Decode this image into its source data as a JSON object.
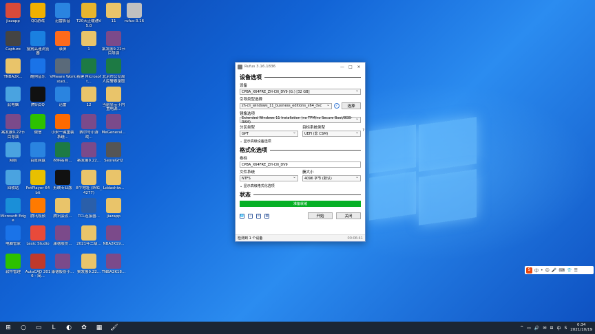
{
  "desktop_icons": [
    {
      "label": "jiazapp",
      "color": "#d84a3a"
    },
    {
      "label": "QQ游戏",
      "color": "#f0b000"
    },
    {
      "label": "迅雷影音",
      "color": "#2a84e0"
    },
    {
      "label": "T20天正暖通V5.0",
      "color": "#e7b52e"
    },
    {
      "label": "11",
      "color": "#e9c46a"
    },
    {
      "label": "rufus-3.16",
      "color": "#c0c0c0"
    },
    {
      "label": "Capture",
      "color": "#444444"
    },
    {
      "label": "搜狗高速浏览器",
      "color": "#1a80e0"
    },
    {
      "label": "录屏",
      "color": "#ff6a1a"
    },
    {
      "label": "1",
      "color": "#e9c46a"
    },
    {
      "label": "案发展9.22节目导演",
      "color": "#7b4a8a"
    },
    {
      "label": "TNBA2K...",
      "color": "#e9c46a"
    },
    {
      "label": "酷狗音乐",
      "color": "#1a73e8"
    },
    {
      "label": "VMware Workstati...",
      "color": "#5a6a7a"
    },
    {
      "label": "新建 Microsoft...",
      "color": "#1d7a44"
    },
    {
      "label": "北京市公安局人民警察录取",
      "color": "#1d7a44"
    },
    {
      "label": "此电脑",
      "color": "#4aa3e0"
    },
    {
      "label": "腾讯QQ",
      "color": "#111111"
    },
    {
      "label": "迅雷",
      "color": "#2a84e0"
    },
    {
      "label": "12",
      "color": "#e9c46a"
    },
    {
      "label": "当前显示于内置电源...",
      "color": "#e9c46a"
    },
    {
      "label": "案发展9.22节目导演",
      "color": "#7b4a8a"
    },
    {
      "label": "微信",
      "color": "#2dc100"
    },
    {
      "label": "小米一键重装系统...",
      "color": "#ff6a00"
    },
    {
      "label": "赛尔号小游戏...",
      "color": "#7b4a8a"
    },
    {
      "label": "MeGeneral...",
      "color": "#7b4a8a"
    },
    {
      "label": "网络",
      "color": "#4aa3e0"
    },
    {
      "label": "百度网盘",
      "color": "#2a84e0"
    },
    {
      "label": "材料名称...",
      "color": "#1d7a44"
    },
    {
      "label": "案发展9.22...",
      "color": "#7b4a8a"
    },
    {
      "label": "SeoreGH2",
      "color": "#555555"
    },
    {
      "label": "回收站",
      "color": "#4aa3e0"
    },
    {
      "label": "PotPlayer 64 bit",
      "color": "#e8c000"
    },
    {
      "label": "剪映专业版",
      "color": "#111111"
    },
    {
      "label": "8个地址 (IMG_4277)",
      "color": "#e9c46a"
    },
    {
      "label": "Lddashiw...",
      "color": "#e9c46a"
    },
    {
      "label": "Microsoft Edge",
      "color": "#1a8fd8"
    },
    {
      "label": "腾讯视频",
      "color": "#ff7a00"
    },
    {
      "label": "腾讯会议...",
      "color": "#e9c46a"
    },
    {
      "label": "TCL连接器...",
      "color": "#2a5faa"
    },
    {
      "label": "jiazapp",
      "color": "#e9c46a"
    },
    {
      "label": "电脑管家",
      "color": "#1a73e8"
    },
    {
      "label": "Lexic Studio",
      "color": "#e84a3a"
    },
    {
      "label": "康德股份...",
      "color": "#7b4a8a"
    },
    {
      "label": "2021年二级...",
      "color": "#e9c46a"
    },
    {
      "label": "NBA2K19...",
      "color": "#7b4a8a"
    },
    {
      "label": "软件管理",
      "color": "#2dc100"
    },
    {
      "label": "AutoCAD 2016 - 简...",
      "color": "#c0392b"
    },
    {
      "label": "康德股份小...",
      "color": "#7b4a8a"
    },
    {
      "label": "案发展9.22...",
      "color": "#e9c46a"
    },
    {
      "label": "TNBA2K18...",
      "color": "#7b4a8a"
    }
  ],
  "rufus": {
    "title": "Rufus 3.16.1836",
    "minimize": "—",
    "maximize": "□",
    "close": "×",
    "device_section": "设备选项",
    "device_label": "设备",
    "device_value": "CPBA_X64FRE_ZH-CN_DV9 (G:) [32 GB]",
    "boot_label": "引导类型选择",
    "boot_value": "zh-cn_windows_11_business_editions_x64_dvc",
    "check_glyph": "✓",
    "select_button": "选择",
    "image_option_label": "镜像选项",
    "image_option_value": "Extended Windows 11 Installation (no TPM/no Secure Boot/8GB- RAM)",
    "partition_label": "分区类型",
    "partition_value": "GPT",
    "target_label": "目标系统类型",
    "target_value": "UEFI (非 CSM)",
    "target_help": "?",
    "advanced_device": "⌄  显示高级设备选项",
    "format_section": "格式化选项",
    "volume_label": "卷标",
    "volume_value": "CPBA_X64FRE_ZH-CN_DV9",
    "fs_label": "文件系统",
    "fs_value": "NTFS",
    "cluster_label": "簇大小",
    "cluster_value": "4096 字节 (默认)",
    "advanced_format": "⌄  显示高级格式化选项",
    "status_section": "状态",
    "status_text": "准备就绪",
    "start_button": "开始",
    "close_button": "关闭",
    "tool_icons": [
      "🌐",
      "ⓘ",
      "≡",
      "▦"
    ],
    "status_bar": "检测到 1 个设备",
    "status_time": "00:06:41"
  },
  "ime": {
    "logo": "S",
    "items": [
      "中",
      "•",
      "☺",
      "🎤",
      "⌨",
      "👕",
      "☰"
    ]
  },
  "taskbar": {
    "items": [
      "⊞",
      "○",
      "▭",
      "L",
      "◐",
      "✿",
      "▦",
      "🖌"
    ],
    "tray_icons": [
      "^",
      "▭",
      "🔊",
      "✉",
      "⊞",
      "中",
      "S"
    ],
    "time": "0:34",
    "date": "2021/10/19"
  }
}
